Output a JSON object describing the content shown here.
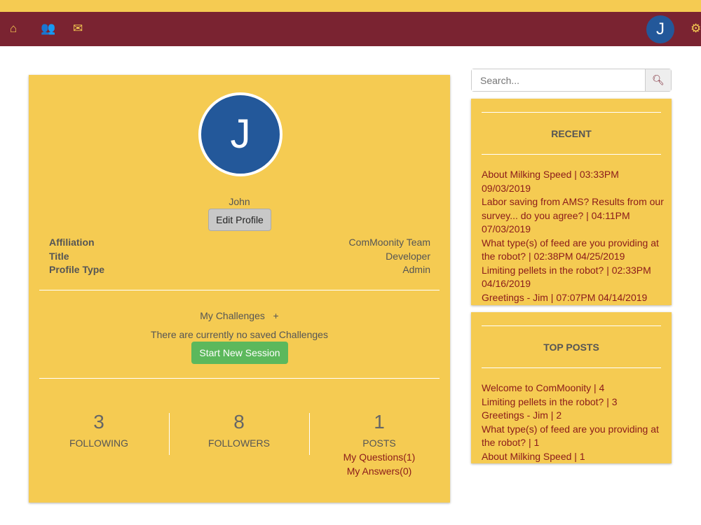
{
  "nav": {
    "icons": [
      "home-icon",
      "users-icon",
      "mail-icon"
    ],
    "avatar_letter": "J"
  },
  "profile": {
    "avatar_letter": "J",
    "name": "John",
    "edit_label": "Edit Profile",
    "fields": [
      {
        "label": "Affiliation",
        "value": "ComMoonity Team"
      },
      {
        "label": "Title",
        "value": "Developer"
      },
      {
        "label": "Profile Type",
        "value": "Admin"
      }
    ]
  },
  "challenges": {
    "title": "My Challenges",
    "add": "+",
    "empty": "There are currently no saved Challenges",
    "start_label": "Start New Session"
  },
  "stats": {
    "following": {
      "count": "3",
      "label": "FOLLOWING"
    },
    "followers": {
      "count": "8",
      "label": "FOLLOWERS"
    },
    "posts": {
      "count": "1",
      "label": "POSTS",
      "questions": "My Questions(1)",
      "answers": "My Answers(0)"
    }
  },
  "search": {
    "placeholder": "Search..."
  },
  "recent": {
    "title": "RECENT",
    "items": [
      "About Milking Speed | 03:33PM 09/03/2019",
      "Labor saving from AMS? Results from our survey... do you agree? | 04:11PM 07/03/2019",
      "What type(s) of feed are you providing at the robot? | 02:38PM 04/25/2019",
      "Limiting pellets in the robot? | 02:33PM 04/16/2019",
      "Greetings - Jim | 07:07PM 04/14/2019"
    ]
  },
  "top_posts": {
    "title": "TOP POSTS",
    "items": [
      "Welcome to ComMoonity | 4",
      "Limiting pellets in the robot? | 3",
      "Greetings - Jim | 2",
      "What type(s) of feed are you providing at the robot? | 1",
      "About Milking Speed | 1"
    ]
  }
}
